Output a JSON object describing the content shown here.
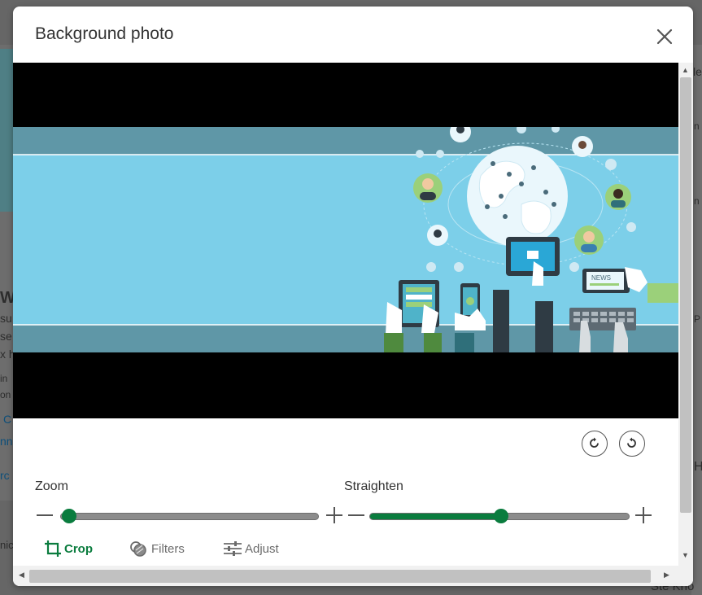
{
  "modal": {
    "title": "Background photo"
  },
  "editor": {
    "zoom_label": "Zoom",
    "straighten_label": "Straighten",
    "zoom_value": 0.0,
    "straighten_value": 0.5
  },
  "tabs": [
    {
      "label": "Crop",
      "active": true
    },
    {
      "label": "Filters",
      "active": false
    },
    {
      "label": "Adjust",
      "active": false
    }
  ],
  "photo": {
    "device_label": "NEWS"
  },
  "background": {
    "right_snippets": [
      "le",
      "n",
      "n",
      "P",
      "H",
      "Ste Kno"
    ],
    "left_snippets": [
      "W",
      "su",
      "se",
      "x h",
      "in",
      "on",
      "C",
      "nn",
      "rc",
      "nic"
    ]
  },
  "colors": {
    "accent": "#0a7c3e",
    "photo_sky": "#7ccfe9",
    "photo_band": "#5f97a7"
  }
}
